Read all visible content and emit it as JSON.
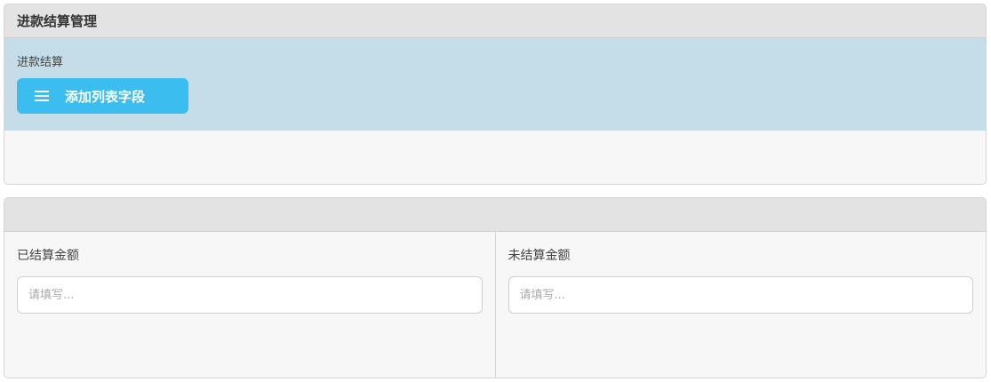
{
  "panel1": {
    "title": "进款结算管理",
    "section_label": "进款结算",
    "add_field_button": "添加列表字段",
    "add_field_icon": "list-icon"
  },
  "panel2": {
    "title": "",
    "fields": [
      {
        "label": "已结算金额",
        "placeholder": "请填写...",
        "value": ""
      },
      {
        "label": "未结算金额",
        "placeholder": "请填写...",
        "value": ""
      }
    ]
  },
  "colors": {
    "header_bg": "#e3e3e3",
    "section_bg": "#c5dde8",
    "button_bg": "#3bbdf0",
    "panel_bg": "#f7f7f7"
  }
}
